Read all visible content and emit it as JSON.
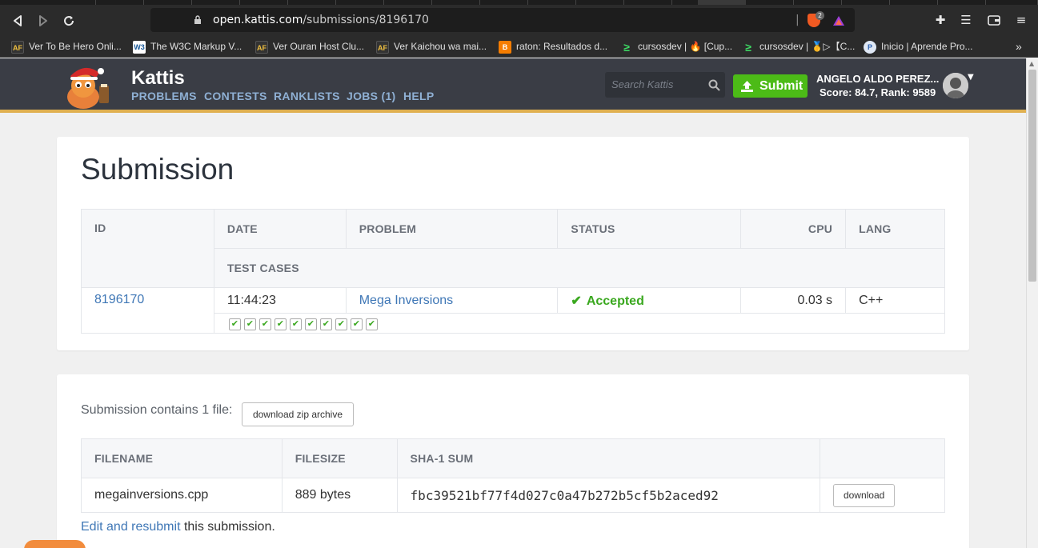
{
  "browser": {
    "url_host": "open.kattis.com",
    "url_path": "/submissions/8196170",
    "brave_badge": "2",
    "bookmarks": [
      {
        "label": "Ver To Be Hero Onli...",
        "icon": "AF"
      },
      {
        "label": "The W3C Markup V...",
        "icon": "W3"
      },
      {
        "label": "Ver Ouran Host Clu...",
        "icon": "AF"
      },
      {
        "label": "Ver Kaichou wa mai...",
        "icon": "AF"
      },
      {
        "label": "raton: Resultados d...",
        "icon": "B"
      },
      {
        "label": "cursosdev | 🔥 [Cup...",
        "icon": "≥"
      },
      {
        "label": "cursosdev | 🥇▷【C...",
        "icon": "≥"
      },
      {
        "label": "Inicio | Aprende Pro...",
        "icon": "P"
      }
    ],
    "more_bookmarks": "»"
  },
  "header": {
    "brand": "Kattis",
    "menu": [
      "PROBLEMS",
      "CONTESTS",
      "RANKLISTS",
      "JOBS (1)",
      "HELP"
    ],
    "search_placeholder": "Search Kattis",
    "submit_label": "Submit",
    "user_name": "ANGELO ALDO PEREZ...",
    "user_score": "Score: 84.7, Rank: 9589"
  },
  "submission": {
    "title": "Submission",
    "headers": {
      "id": "ID",
      "date": "DATE",
      "problem": "PROBLEM",
      "status": "STATUS",
      "cpu": "CPU",
      "lang": "LANG",
      "test_cases": "TEST CASES"
    },
    "id": "8196170",
    "date": "11:44:23",
    "problem": "Mega Inversions",
    "status": "Accepted",
    "cpu": "0.03 s",
    "lang": "C++",
    "test_case_count": 10
  },
  "files": {
    "intro": "Submission contains 1 file:",
    "zip_label": "download zip archive",
    "headers": {
      "filename": "FILENAME",
      "filesize": "FILESIZE",
      "sha": "SHA-1 SUM"
    },
    "filename": "megainversions.cpp",
    "filesize": "889 bytes",
    "sha": "fbc39521bf77f4d027c0a47b272b5cf5b2aced92",
    "download_label": "download",
    "edit_link": "Edit and resubmit",
    "edit_suffix": " this submission."
  },
  "colors": {
    "accent_green": "#4cbb17",
    "accepted": "#3aa81f",
    "link": "#3f77b6",
    "header_bg": "#3a3d45",
    "header_stripe": "#e0b050"
  }
}
